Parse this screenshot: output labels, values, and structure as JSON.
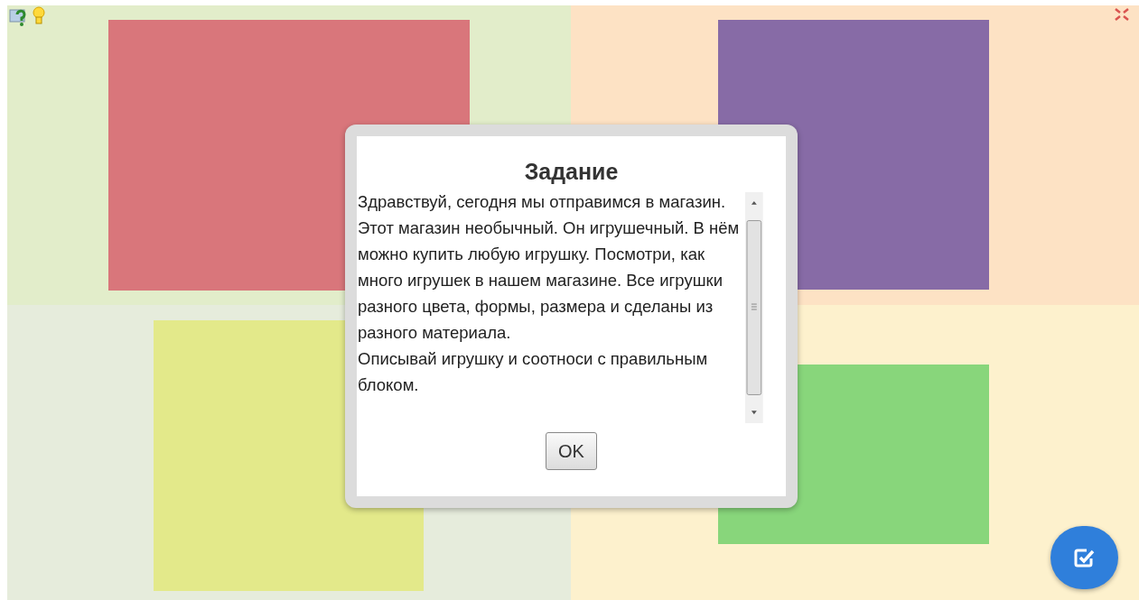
{
  "zones": [
    {
      "color": "#d9767b"
    },
    {
      "color": "#876ba6"
    },
    {
      "color": "#e3e98a"
    },
    {
      "color": "#88d67b"
    }
  ],
  "dialog": {
    "title": "Задание",
    "paragraphs": [
      "Здравствуй, сегодня мы отправимся в магазин. Этот магазин необычный. Он игрушечный. В нём можно купить любую игрушку. Посмотри, как много игрушек в нашем магазине. Все игрушки разного цвета, формы, размера и сделаны из разного материала.",
      "Описывай игрушку и соотноси с правильным блоком."
    ],
    "button": "OK"
  }
}
